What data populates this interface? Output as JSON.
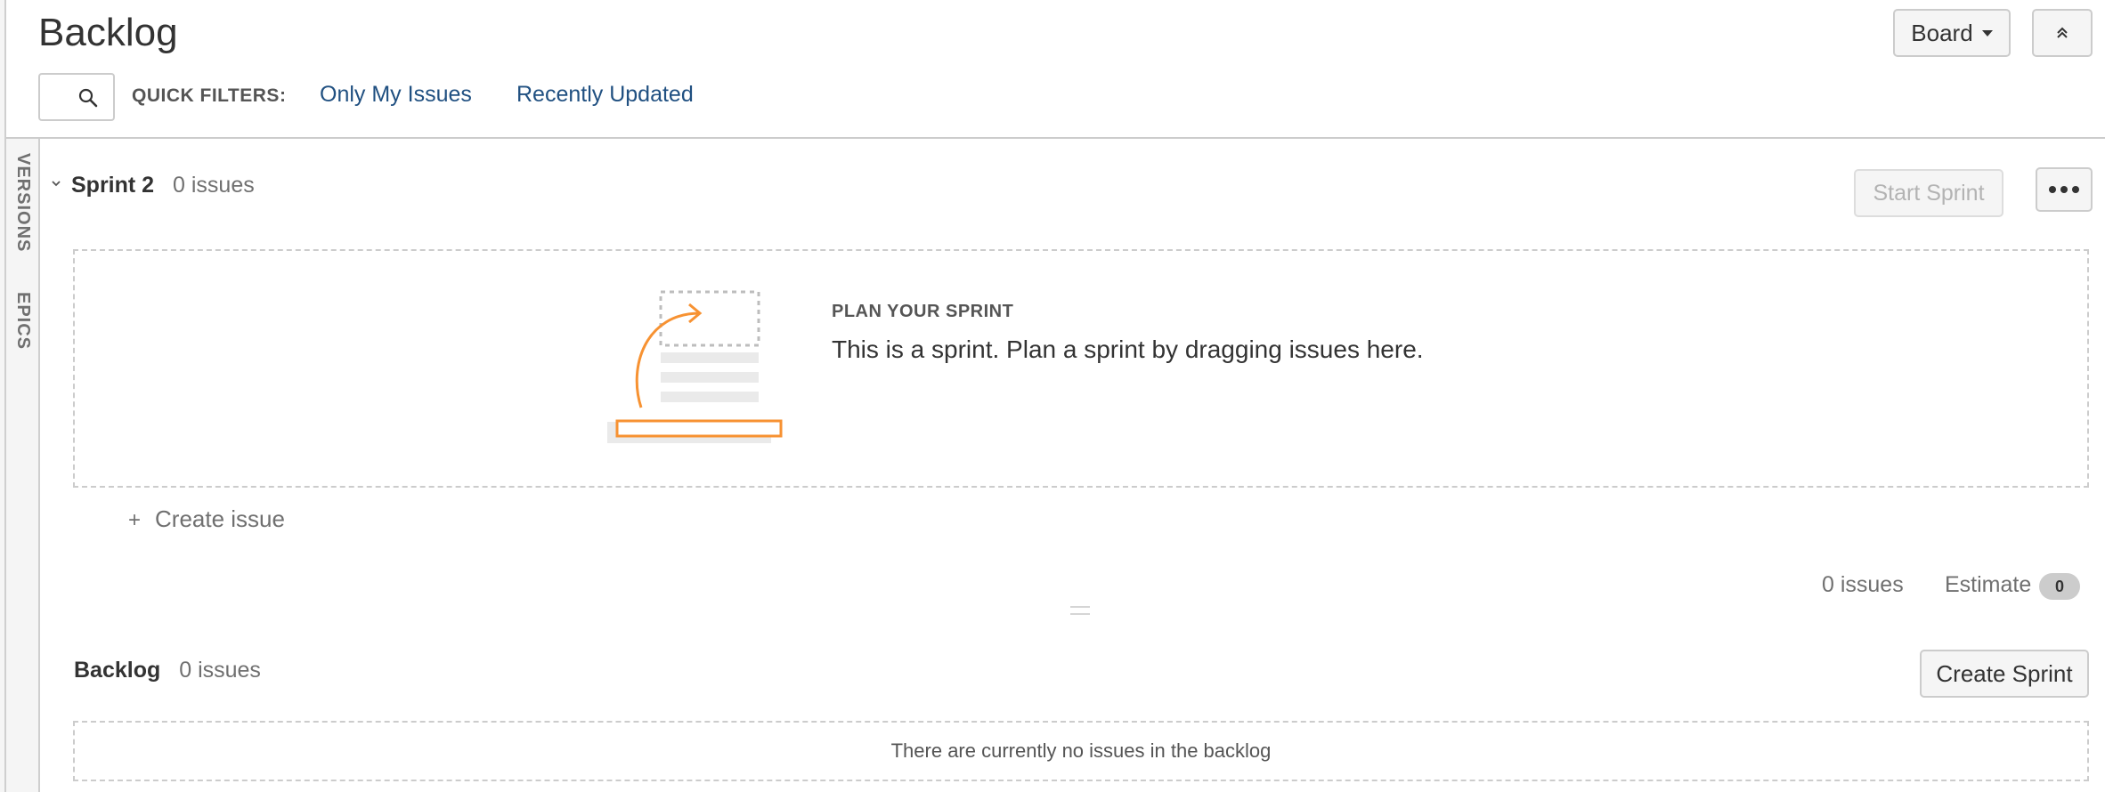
{
  "header": {
    "title": "Backlog",
    "board_button": "Board",
    "collapse_icon": "double-chevron-up-icon"
  },
  "quick_filters": {
    "label": "QUICK FILTERS:",
    "search_icon": "search-icon",
    "filters": [
      "Only My Issues",
      "Recently Updated"
    ]
  },
  "side_rail": {
    "tabs": [
      "VERSIONS",
      "EPICS"
    ]
  },
  "sprint": {
    "name": "Sprint 2",
    "issue_count": "0 issues",
    "start_button": "Start Sprint",
    "more_icon": "more-dots-icon",
    "empty_title": "PLAN YOUR SPRINT",
    "empty_text": "This is a sprint. Plan a sprint by dragging issues here.",
    "create_issue": "Create issue",
    "footer_count": "0 issues",
    "estimate_label": "Estimate",
    "estimate_value": "0"
  },
  "backlog": {
    "name": "Backlog",
    "issue_count": "0 issues",
    "create_sprint_button": "Create Sprint",
    "empty_text": "There are currently no issues in the backlog"
  },
  "colors": {
    "link": "#205081",
    "illustration_accent": "#f79232",
    "border": "#cccccc",
    "muted_text": "#707070"
  }
}
